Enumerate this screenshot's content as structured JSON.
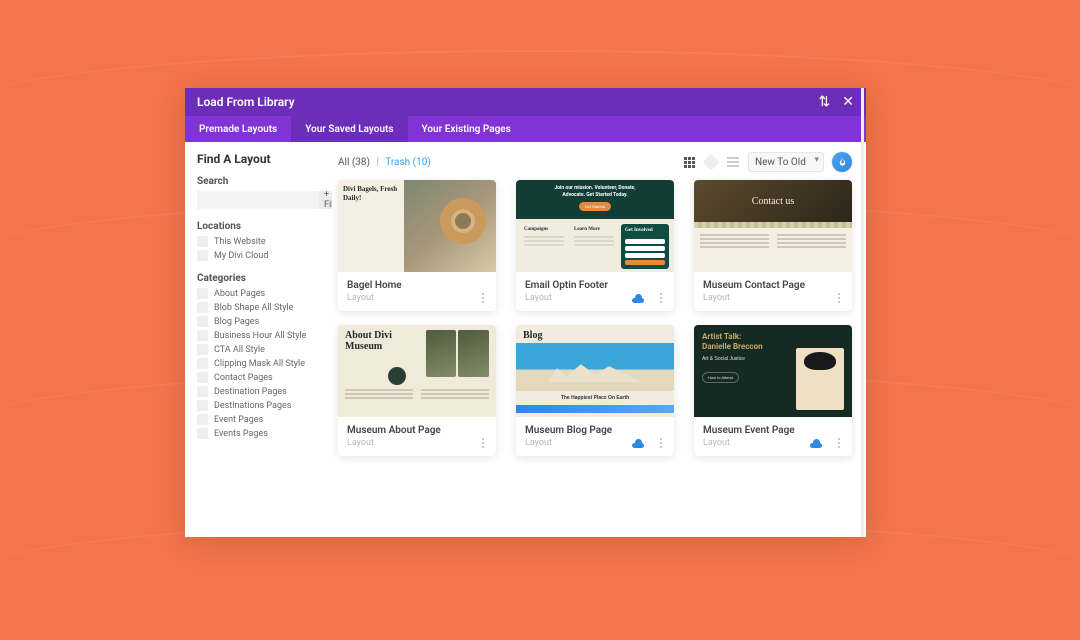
{
  "header": {
    "title": "Load From Library"
  },
  "tabs": [
    {
      "label": "Premade Layouts",
      "active": false
    },
    {
      "label": "Your Saved Layouts",
      "active": true
    },
    {
      "label": "Your Existing Pages",
      "active": false
    }
  ],
  "sidebar": {
    "title": "Find A Layout",
    "search_label": "Search",
    "filter_chip": "+ Filter",
    "locations_label": "Locations",
    "locations": [
      "This Website",
      "My Divi Cloud"
    ],
    "categories_label": "Categories",
    "categories": [
      "About Pages",
      "Blob Shape All Style",
      "Blog Pages",
      "Business Hour All Style",
      "CTA All Style",
      "Clipping Mask All Style",
      "Contact Pages",
      "Destination Pages",
      "Destinations Pages",
      "Event Pages",
      "Events Pages"
    ]
  },
  "topline": {
    "all_label": "All",
    "all_count": "38",
    "trash_label": "Trash",
    "trash_count": "10",
    "sort_value": "New To Old"
  },
  "cards": [
    {
      "name": "Bagel Home",
      "type": "Layout",
      "cloud": false,
      "thumb_class": "t-bagel",
      "thumb_text": {
        "h": "Divi Bagels, Fresh Daily!"
      }
    },
    {
      "name": "Email Optin Footer",
      "type": "Layout",
      "cloud": true,
      "thumb_class": "t-optin",
      "thumb_text": {
        "l1": "Join our mission. Volunteer, Donate,",
        "l2": "Advocate. Get Started Today.",
        "c1": "Campaigns",
        "c2": "Learn More",
        "c3": "Get Involved"
      }
    },
    {
      "name": "Museum Contact Page",
      "type": "Layout",
      "cloud": false,
      "thumb_class": "t-contact",
      "thumb_text": {
        "h": "Contact us"
      }
    },
    {
      "name": "Museum About Page",
      "type": "Layout",
      "cloud": false,
      "thumb_class": "t-about",
      "thumb_text": {
        "h": "About Divi Museum"
      }
    },
    {
      "name": "Museum Blog Page",
      "type": "Layout",
      "cloud": true,
      "thumb_class": "t-blog",
      "thumb_text": {
        "h": "Blog",
        "cap": "The Happiest Place On Earth"
      }
    },
    {
      "name": "Museum Event Page",
      "type": "Layout",
      "cloud": true,
      "thumb_class": "t-event",
      "thumb_text": {
        "h1": "Artist Talk:",
        "h2": "Danielle Breccon",
        "sub": "Art & Social Justice",
        "btn": "How to Attend"
      }
    }
  ]
}
